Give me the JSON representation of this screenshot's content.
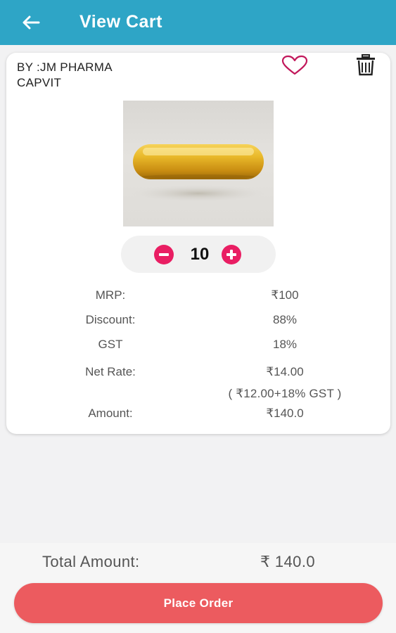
{
  "appbar": {
    "title": "View Cart",
    "back_icon": "arrow-left-icon",
    "background": "#2ea5c6"
  },
  "cart_item": {
    "by_line": "BY :JM PHARMA",
    "name": "CAPVIT",
    "wishlist_icon": "heart-outline-icon",
    "delete_icon": "trash-icon",
    "image": "softgel-capsule",
    "quantity": "10",
    "minus_icon": "minus-circle-icon",
    "plus_icon": "plus-circle-icon",
    "details": {
      "mrp_label": "MRP:",
      "mrp_value": "₹100",
      "discount_label": "Discount:",
      "discount_value": "88%",
      "gst_label": "GST",
      "gst_value": "18%",
      "net_rate_label": "Net Rate:",
      "net_rate_value": "₹14.00",
      "net_rate_note": "( ₹12.00+18% GST )",
      "amount_label": "Amount:",
      "amount_value": "₹140.0"
    }
  },
  "footer": {
    "total_label": "Total Amount:",
    "total_value": "₹ 140.0",
    "place_order_label": "Place Order",
    "button_color": "#ec5b5f"
  },
  "colors": {
    "accent": "#e91e63",
    "heart": "#c2185b"
  }
}
